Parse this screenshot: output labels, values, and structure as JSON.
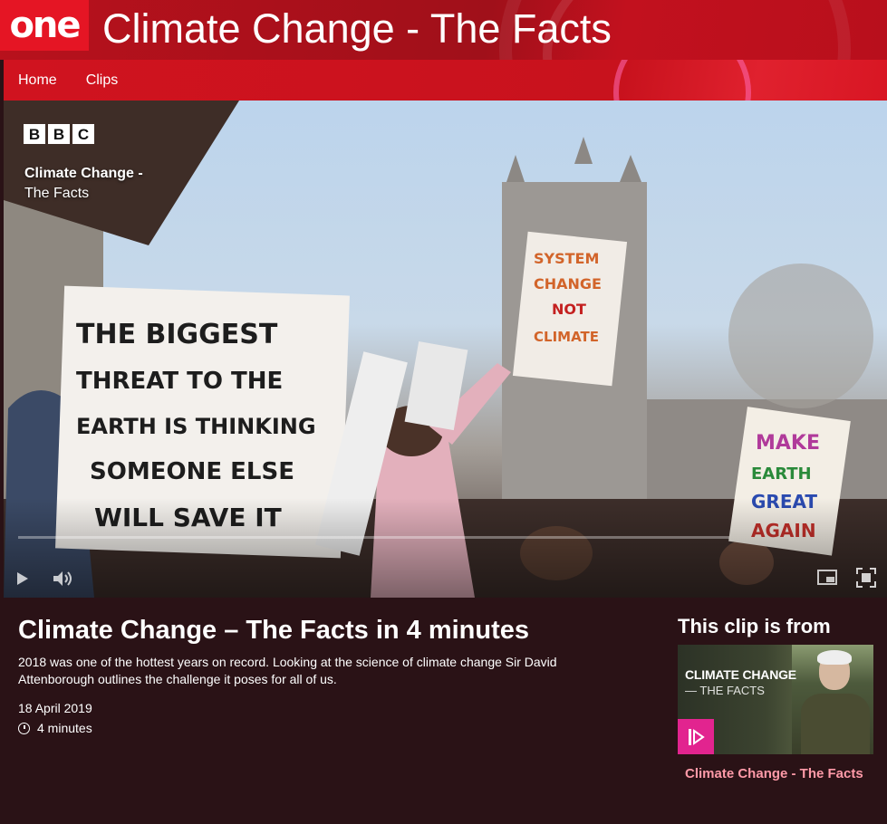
{
  "header": {
    "logo_text": "one",
    "title": "Climate Change - The Facts"
  },
  "nav": {
    "items": [
      {
        "label": "Home"
      },
      {
        "label": "Clips"
      }
    ]
  },
  "player": {
    "brand": [
      "B",
      "B",
      "C"
    ],
    "overlay_title_line1": "Climate Change -",
    "overlay_title_line2": "The Facts",
    "progress_fraction": 0.0,
    "colors": {
      "progress": "#d4145a",
      "track": "#ffffff"
    },
    "icons": [
      "play-icon",
      "volume-icon",
      "picture-in-picture-icon",
      "fullscreen-icon"
    ]
  },
  "clip": {
    "title": "Climate Change – The Facts in 4 minutes",
    "description": "2018 was one of the hottest years on record. Looking at the science of climate change Sir David Attenborough outlines the challenge it poses for all of us.",
    "date": "18 April 2019",
    "duration": "4 minutes"
  },
  "from": {
    "heading": "This clip is from",
    "card_title": "CLIMATE CHANGE",
    "card_subtitle": "— THE FACTS",
    "link": "Climate Change - The Facts",
    "colors": {
      "link": "#ff9aa8",
      "badge": "#e2248f"
    }
  },
  "colors": {
    "brand_red": "#b8111c",
    "logo_red": "#e51524",
    "nav_red": "#d0131f",
    "background": "#2a1216"
  }
}
